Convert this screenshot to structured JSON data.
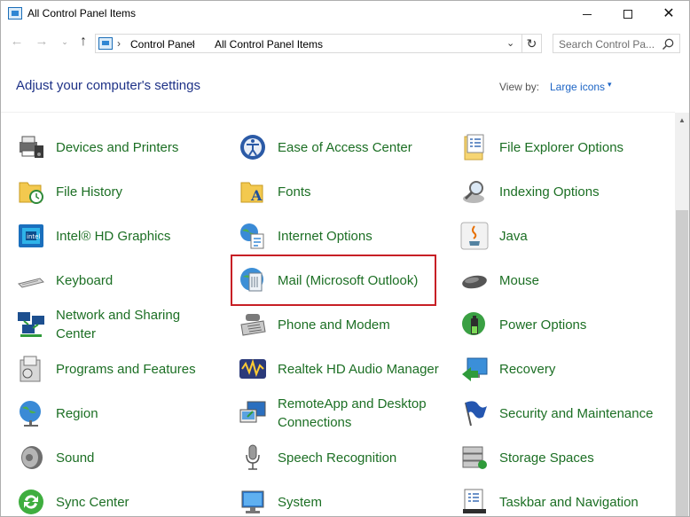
{
  "window": {
    "title": "All Control Panel Items",
    "minimize_icon": "minimize-icon",
    "maximize_icon": "maximize-icon",
    "close_label": "✕"
  },
  "nav": {
    "back": "←",
    "forward": "→",
    "recent": "⌄",
    "up": "↑",
    "breadcrumb": [
      "Control Panel",
      "All Control Panel Items"
    ],
    "separator": "›",
    "dropdown": "⌄",
    "refresh": "↻"
  },
  "search": {
    "placeholder": "Search Control Pa..."
  },
  "header": {
    "title": "Adjust your computer's settings",
    "view_by_label": "View by:",
    "view_by_value": "Large icons",
    "caret": "▾"
  },
  "items": {
    "devices_and_printers": "Devices and Printers",
    "ease_of_access_center": "Ease of Access Center",
    "file_explorer_options": "File Explorer Options",
    "file_history": "File History",
    "fonts": "Fonts",
    "indexing_options": "Indexing Options",
    "intel_hd_graphics": "Intel® HD Graphics",
    "internet_options": "Internet Options",
    "java": "Java",
    "keyboard": "Keyboard",
    "mail": "Mail (Microsoft Outlook)",
    "mouse": "Mouse",
    "network_and_sharing_1": "Network and Sharing",
    "network_and_sharing_2": "Center",
    "phone_and_modem": "Phone and Modem",
    "power_options": "Power Options",
    "programs_and_features": "Programs and Features",
    "realtek_hd_audio_manager": "Realtek HD Audio Manager",
    "recovery": "Recovery",
    "region": "Region",
    "remoteapp_1": "RemoteApp and Desktop",
    "remoteapp_2": "Connections",
    "security_and_maintenance": "Security and Maintenance",
    "sound": "Sound",
    "speech_recognition": "Speech Recognition",
    "storage_spaces": "Storage Spaces",
    "sync_center": "Sync Center",
    "system": "System",
    "taskbar_and_navigation": "Taskbar and Navigation"
  },
  "colors": {
    "link_green": "#1c6f24",
    "title_blue": "#1e3287",
    "view_by_blue": "#1c64c5",
    "highlight_red": "#c71f25"
  },
  "scrollbar": {
    "up_arrow": "▲"
  }
}
